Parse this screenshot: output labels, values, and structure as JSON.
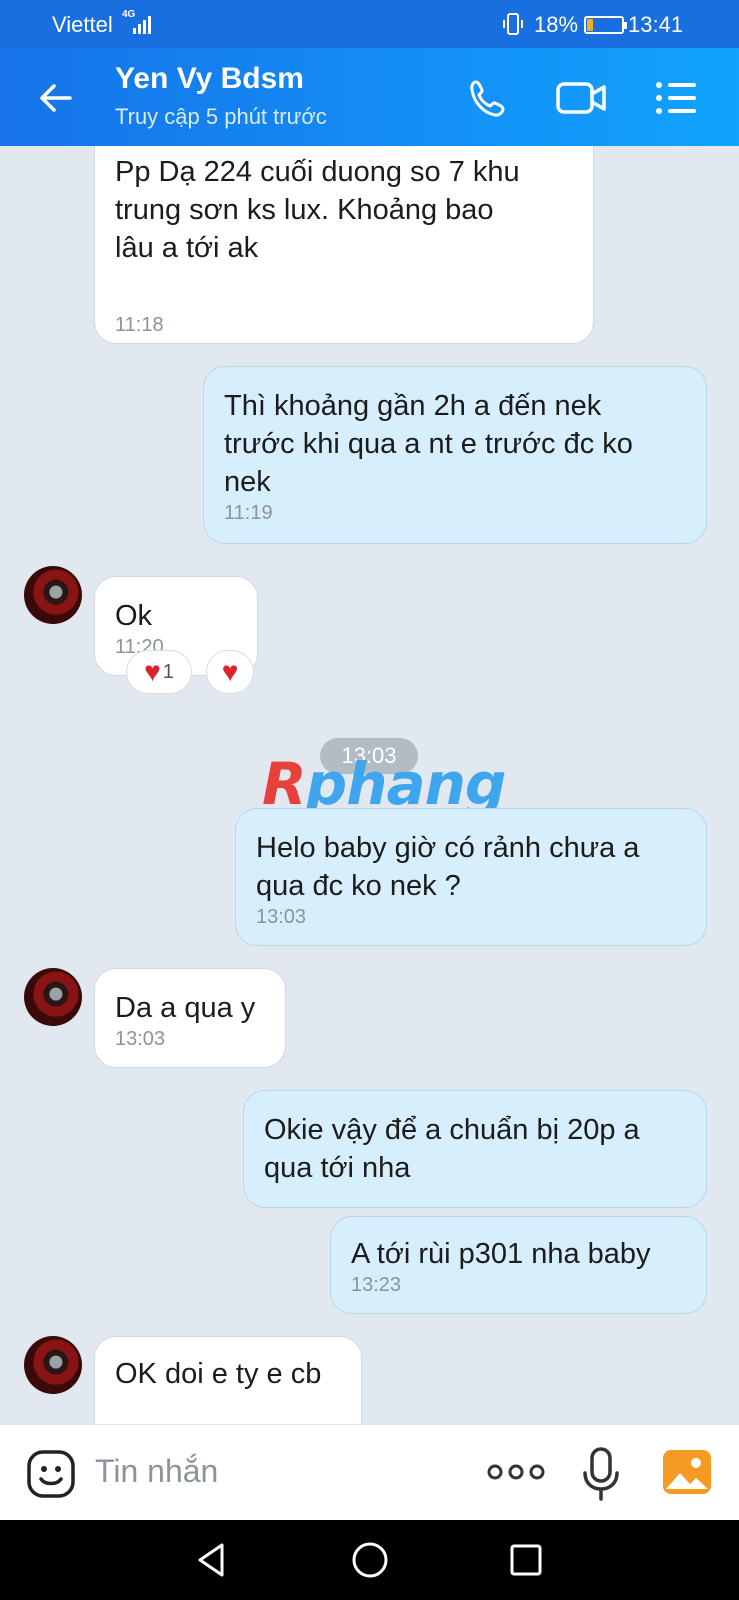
{
  "status_bar": {
    "carrier": "Viettel",
    "network": "4G",
    "battery": "18%",
    "battery_level": 0.18,
    "time": "13:41"
  },
  "header": {
    "name": "Yen Vy Bdsm",
    "subtitle": "Truy cập 5 phút trước",
    "icons": [
      "back-arrow-icon",
      "phone-icon",
      "video-call-icon",
      "menu-list-icon"
    ]
  },
  "messages": [
    {
      "dir": "in",
      "lines": [
        "Pp Dạ 224 cuối duong so 7 khu",
        "trung sơn ks lux. Khoảng bao",
        "lâu a tới ak"
      ],
      "time": "11:18"
    },
    {
      "dir": "out",
      "lines": [
        "Thì khoảng gần 2h a đến nek",
        "trước khi qua a nt e trước đc ko",
        "nek"
      ],
      "time": "11:19"
    },
    {
      "dir": "in",
      "lines": [
        "Ok"
      ],
      "time": "11:20",
      "reaction_count": "1"
    },
    {
      "dir": "out",
      "lines": [
        "Helo baby giờ có rảnh chưa a",
        "qua đc ko nek ?"
      ],
      "time": "13:03"
    },
    {
      "dir": "in",
      "lines": [
        "Da a qua y"
      ],
      "time": "13:03"
    },
    {
      "dir": "out",
      "lines": [
        "Okie vậy để a chuẩn bị 20p a",
        "qua tới nha"
      ]
    },
    {
      "dir": "out",
      "lines": [
        "A tới rùi p301 nha baby"
      ],
      "time": "13:23"
    },
    {
      "dir": "in",
      "lines": [
        "OK doi e ty e cb"
      ]
    }
  ],
  "time_separator": "13:03",
  "watermark": {
    "first": "R",
    "rest": "phang"
  },
  "input": {
    "placeholder": "Tin nhắn"
  },
  "colors": {
    "header": "#1673e8",
    "outgoing_bubble": "#d7effd",
    "incoming_bubble": "#ffffff",
    "background": "#e2e8ef",
    "heart": "#e0202e"
  }
}
